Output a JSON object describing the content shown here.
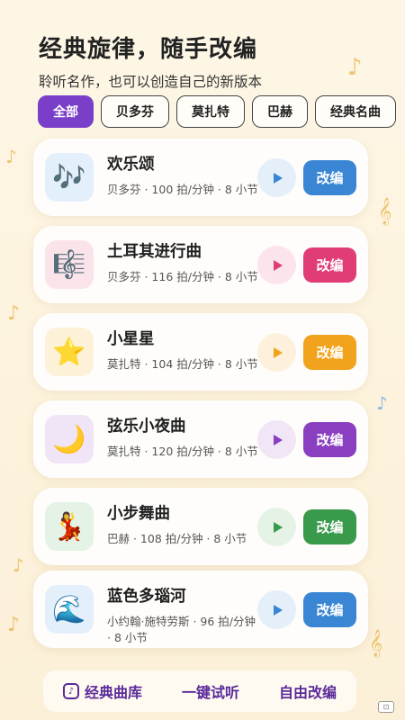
{
  "header": {
    "title": "经典旋律，随手改编",
    "subtitle": "聆听名作，也可以创造自己的新版本"
  },
  "filters": [
    {
      "label": "全部",
      "active": true
    },
    {
      "label": "贝多芬",
      "active": false
    },
    {
      "label": "莫扎特",
      "active": false
    },
    {
      "label": "巴赫",
      "active": false
    },
    {
      "label": "经典名曲",
      "active": false
    }
  ],
  "songs": [
    {
      "title": "欢乐颂",
      "meta": "贝多芬 · 100 拍/分钟 · 8 小节",
      "icon": "🎶",
      "icon_name": "music-notes-icon",
      "thumb_bg": "#e3effb",
      "play_bg": "#e4effa",
      "accent": "#3a86d4",
      "edit_label": "改编"
    },
    {
      "title": "土耳其进行曲",
      "meta": "贝多芬 · 116 拍/分钟 · 8 小节",
      "icon": "🎼",
      "icon_name": "musical-score-icon",
      "thumb_bg": "#fbe3ea",
      "play_bg": "#fbe4ec",
      "accent": "#e03d77",
      "edit_label": "改编"
    },
    {
      "title": "小星星",
      "meta": "莫扎特 · 104 拍/分钟 · 8 小节",
      "icon": "⭐",
      "icon_name": "star-icon",
      "thumb_bg": "#fdf1d8",
      "play_bg": "#fdf1dc",
      "accent": "#f2a31d",
      "edit_label": "改编"
    },
    {
      "title": "弦乐小夜曲",
      "meta": "莫扎特 · 120 拍/分钟 · 8 小节",
      "icon": "🌙",
      "icon_name": "crescent-moon-icon",
      "thumb_bg": "#efe5f6",
      "play_bg": "#f0e6f6",
      "accent": "#8a3ec0",
      "edit_label": "改编"
    },
    {
      "title": "小步舞曲",
      "meta": "巴赫 · 108 拍/分钟 · 8 小节",
      "icon": "💃",
      "icon_name": "dancer-icon",
      "thumb_bg": "#e4f3e6",
      "play_bg": "#e5f3e6",
      "accent": "#3a9a4b",
      "edit_label": "改编"
    },
    {
      "title": "蓝色多瑙河",
      "meta": "小约翰·施特劳斯 · 96 拍/分钟 · 8 小节",
      "icon": "🌊",
      "icon_name": "wave-icon",
      "thumb_bg": "#e3effb",
      "play_bg": "#e4effa",
      "accent": "#3a86d4",
      "edit_label": "改编"
    }
  ],
  "bottom_tabs": [
    {
      "label": "经典曲库",
      "icon": "library-icon"
    },
    {
      "label": "一键试听",
      "icon": ""
    },
    {
      "label": "自由改编",
      "icon": ""
    }
  ],
  "colors": {
    "primary": "#7a3fc8",
    "background": "#fdf6e6"
  }
}
